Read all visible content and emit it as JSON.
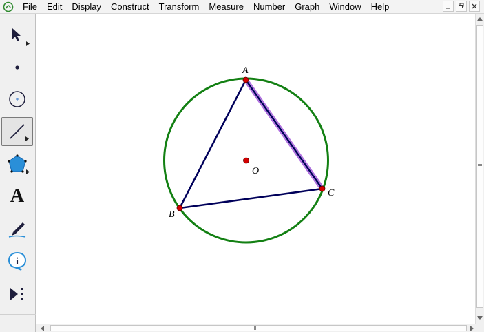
{
  "menu": {
    "items": [
      "File",
      "Edit",
      "Display",
      "Construct",
      "Transform",
      "Measure",
      "Number",
      "Graph",
      "Window",
      "Help"
    ]
  },
  "window_controls": [
    "minimize-icon",
    "restore-icon",
    "close-icon"
  ],
  "toolbox": {
    "tools": [
      {
        "name": "selection-arrow-tool",
        "icon": "arrow-icon",
        "selected": false
      },
      {
        "name": "point-tool",
        "icon": "point-icon",
        "selected": false
      },
      {
        "name": "compass-tool",
        "icon": "circle-icon",
        "selected": false
      },
      {
        "name": "straightedge-tool",
        "icon": "segment-icon",
        "selected": true
      },
      {
        "name": "polygon-tool",
        "icon": "pentagon-icon",
        "selected": false
      },
      {
        "name": "text-tool",
        "icon": "text-A-icon",
        "label": "A",
        "selected": false
      },
      {
        "name": "marker-tool",
        "icon": "pen-icon",
        "selected": false
      },
      {
        "name": "information-tool",
        "icon": "info-icon",
        "label": "i",
        "selected": false
      },
      {
        "name": "custom-tools",
        "icon": "play-more-icon",
        "selected": false
      }
    ]
  },
  "sketch": {
    "points": [
      {
        "id": "A",
        "label": "A"
      },
      {
        "id": "B",
        "label": "B"
      },
      {
        "id": "C",
        "label": "C"
      },
      {
        "id": "O",
        "label": "O"
      }
    ],
    "colors": {
      "circle": "#138013",
      "triangle": "#00005a",
      "highlight": "#b06ee0",
      "point": "#d40000"
    }
  }
}
